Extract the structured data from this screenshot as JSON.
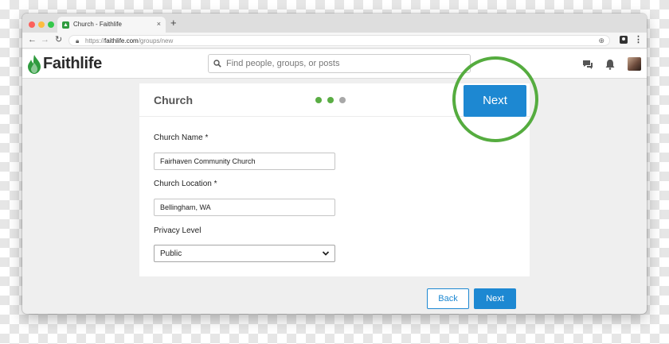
{
  "browser": {
    "tab_title": "Church - Faithlife",
    "new_tab_symbol": "+",
    "close_symbol": "×",
    "url_scheme": "https://",
    "url_host": "faithlife.com",
    "url_path": "/groups/new"
  },
  "header": {
    "logo_text": "Faithlife",
    "search_placeholder": "Find people, groups, or posts"
  },
  "card": {
    "title": "Church",
    "steps": [
      {
        "state": "complete",
        "color": "#5aad44"
      },
      {
        "state": "current",
        "color": "#5aad44"
      },
      {
        "state": "pending",
        "color": "#a8a8a8"
      }
    ],
    "next_label": "Next"
  },
  "form": {
    "church_name_label": "Church Name *",
    "church_name_value": "Fairhaven Community Church",
    "church_location_label": "Church Location *",
    "church_location_value": "Bellingham, WA",
    "privacy_label": "Privacy Level",
    "privacy_value": "Public"
  },
  "footer": {
    "back_label": "Back",
    "next_label": "Next"
  },
  "colors": {
    "brand_green": "#2f9b3e",
    "primary_blue": "#1d88d2",
    "highlight_green": "#55ac3f"
  }
}
